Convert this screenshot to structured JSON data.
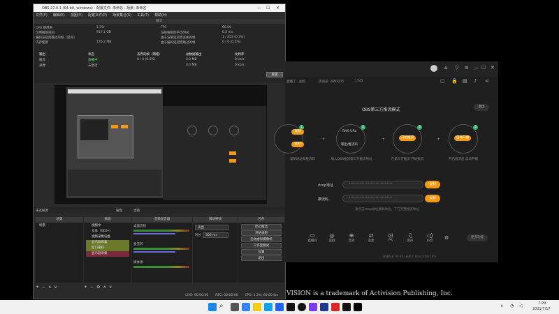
{
  "obs": {
    "title": "OBS 27.0.1 (64-bit, windows) - 配置文件: 未命名 - 场景: 未命名",
    "menu": [
      "文件(F)",
      "编辑(E)",
      "视图(V)",
      "配置文件(P)",
      "场景集合(S)",
      "工具(T)",
      "帮助(H)"
    ],
    "stats": {
      "header": "统计",
      "cpu_label": "CPU 使用率",
      "cpu_value": "1.3%",
      "disk_label": "可用磁盘空间",
      "disk_value": "917.1 GB",
      "skipped_enc_label": "编码滞后而跳过的帧（空间）",
      "skipped_enc_value": "",
      "mem_label": "内存使用",
      "mem_value": "176.2 MB",
      "fps_label": "FPS",
      "fps_value": "60.00",
      "render_time_label": "渲染每帧的平均时间",
      "render_time_value": "0.3 ms",
      "missed_render_label": "由于渲染延迟而丢失的帧",
      "missed_render_value": "1 / 353 (0.3%)",
      "skipped_enc2_label": "由于编码延迟而跳过的帧",
      "skipped_enc2_value": "0 / 0 (0.0%)",
      "table_headers": [
        "输出",
        "状态",
        "丢弃的帧（网络）",
        "总数据输出",
        "比特率"
      ],
      "rows": [
        {
          "name": "推流",
          "status": "直播中",
          "dropped": "0 / 0 (0.0%)",
          "total": "0.0 MB",
          "bitrate": "0 kb/s"
        },
        {
          "name": "录像",
          "status": "未激活",
          "dropped": "",
          "total": "0.0 MB",
          "bitrate": "0 kb/s"
        }
      ],
      "reset_label": "重置"
    },
    "scene_bar_label": "未选择源",
    "filter_label": "属性",
    "filter2_label": "滤镜",
    "docks": {
      "scenes_title": "场景",
      "sources_title": "来源",
      "mixer_title": "音频混音器",
      "transitions_title": "转场特效",
      "controls_title": "控件",
      "scene_item": "场景",
      "sources": [
        "视频中",
        "文本（GDI+）",
        "视频采集设备",
        "显示器采集",
        "窗口捕获",
        "显示器采集"
      ],
      "mixer_tracks": [
        "桌面音频",
        "麦克风",
        "媒体源"
      ],
      "transition_value": "淡出",
      "duration_label": "时长",
      "duration_value": "300 ms",
      "controls": [
        "停止推流",
        "开始录制",
        "启动虚拟摄像机",
        "工作室模式",
        "设置",
        "退出"
      ]
    },
    "status": {
      "live": "LIVE: 00:00:00",
      "rec": "REC: 00:00:00",
      "cpu": "CPU: 1.3%, 60.00 fps"
    }
  },
  "app": {
    "subbar_left": "直播了 · 主机",
    "subbar_id": "房间号: 2893225",
    "subbar_views": "1745",
    "heading": "OBS第三方推流模式",
    "exit_label": "退出",
    "steps": [
      {
        "num": "1",
        "pill": "复制",
        "caption": "复制地址和推流码"
      },
      {
        "num": "2",
        "pill": "",
        "center": "RMS URL",
        "center2": "输出/推流码",
        "caption": "填入OBS推流第三方推流地址"
      },
      {
        "num": "3",
        "pill": "开始推流",
        "caption": "在第三方推流 开始推流"
      },
      {
        "num": "4",
        "pill": "自动开播",
        "caption": "开启推流后 自动开播"
      }
    ],
    "rtmp_label": "rtmp地址",
    "rtmp_value": "****************************",
    "stream_key_label": "推流码",
    "stream_key_value": "****************************",
    "copy_label": "复制",
    "notice": "请点击rtmp地址复制地址，下方完整推流地址",
    "tools": [
      "直播间",
      "美颜",
      "音效",
      "连麦",
      "PK",
      "变声",
      "声音"
    ],
    "more_label": "更多功能",
    "footer": "直播时长 00:06  |  码率 0 kb/s  |  CPU 18%"
  },
  "overlay_text": "VISION is a trademark of Activision Publishing, Inc.",
  "taskbar": {
    "time": "7:29",
    "date": "2021/7/17"
  },
  "colors": {
    "accent": "#f59a16",
    "live": "#5cff5c",
    "step_badge": "#3ab36b"
  }
}
